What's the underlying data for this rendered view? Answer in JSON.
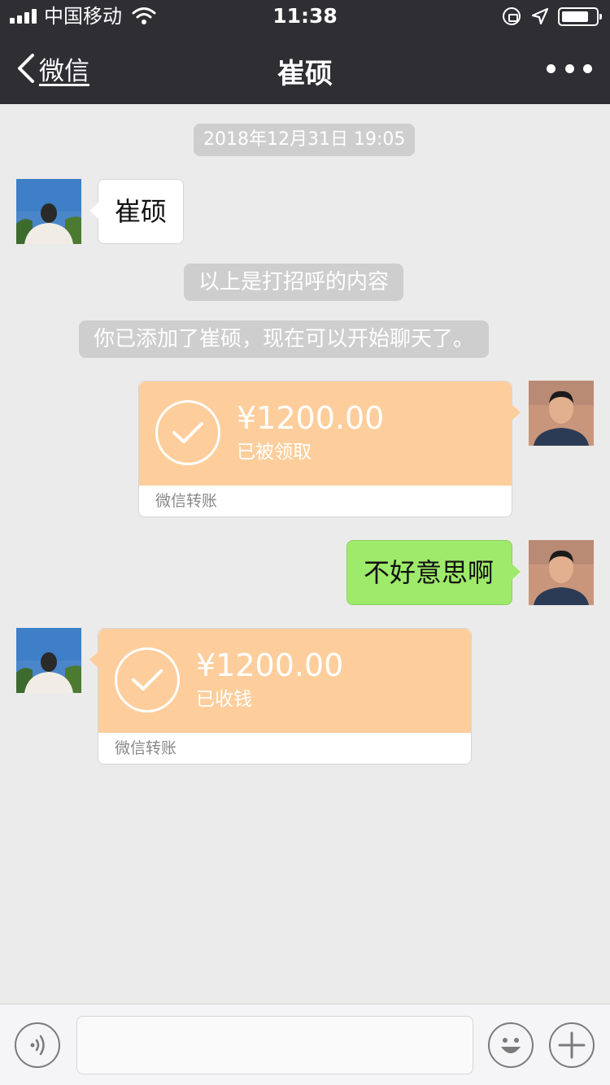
{
  "status_bar": {
    "carrier": "中国移动",
    "time": "11:38"
  },
  "nav": {
    "back_label": "微信",
    "title": "崔硕"
  },
  "timestamp": "2018年12月31日 19:05",
  "system_messages": [
    "以上是打招呼的内容",
    "你已添加了崔硕，现在可以开始聊天了。"
  ],
  "messages": [
    {
      "from": "other",
      "type": "text",
      "text": "崔硕"
    },
    {
      "from": "me",
      "type": "transfer",
      "amount": "¥1200.00",
      "status": "已被领取",
      "footer": "微信转账"
    },
    {
      "from": "me",
      "type": "text",
      "text": "不好意思啊"
    },
    {
      "from": "other",
      "type": "transfer",
      "amount": "¥1200.00",
      "status": "已收钱",
      "footer": "微信转账"
    }
  ],
  "input": {
    "placeholder": ""
  },
  "colors": {
    "nav_bg": "#2e2e33",
    "chat_bg": "#ebebeb",
    "bubble_green": "#9eea6a",
    "transfer_orange": "#fdce9c"
  },
  "icons": [
    "signal-icon",
    "wifi-icon",
    "orientation-lock-icon",
    "location-icon",
    "battery-icon",
    "back-chevron-icon",
    "more-icon",
    "check-icon",
    "voice-icon",
    "emoji-icon",
    "plus-icon"
  ]
}
